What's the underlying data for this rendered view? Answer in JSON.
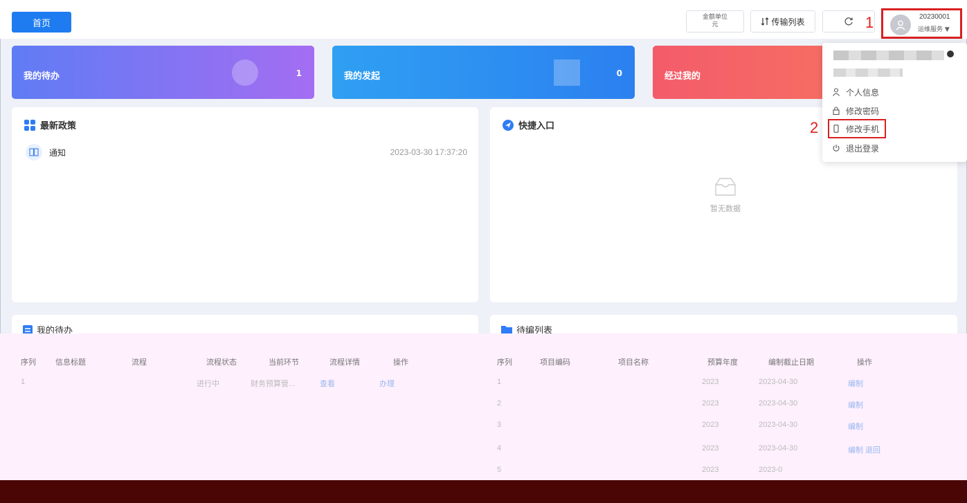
{
  "topbar": {
    "home_tab": "首页",
    "unit_label": "金额单位",
    "unit_value": "元",
    "transfer_list": "传输列表",
    "user_id": "20230001",
    "user_role": "运维服务"
  },
  "callouts": {
    "first": "1",
    "second": "2"
  },
  "stats": [
    {
      "label": "我的待办",
      "count": "1"
    },
    {
      "label": "我的发起",
      "count": "0"
    },
    {
      "label": "经过我的",
      "count": ""
    }
  ],
  "policy": {
    "title": "最新政策",
    "items": [
      {
        "text": "通知",
        "date": "2023-03-30 17:37:20"
      }
    ]
  },
  "quick": {
    "title": "快捷入口",
    "empty_text": "暂无数据"
  },
  "todo": {
    "title": "我的待办",
    "headers": [
      "序列",
      "信息标题",
      "流程",
      "流程状态",
      "当前环节",
      "流程详情",
      "操作"
    ],
    "rows": [
      {
        "seq": "1",
        "status": "进行中",
        "step": "财务预算管...",
        "detail": "查看",
        "action": "办理"
      }
    ]
  },
  "list": {
    "title": "待编列表",
    "headers": [
      "序列",
      "项目编码",
      "项目名称",
      "预算年度",
      "编制截止日期",
      "操作"
    ],
    "rows": [
      {
        "seq": "1",
        "year": "2023",
        "deadline": "2023-04-30",
        "action": "编制"
      },
      {
        "seq": "2",
        "year": "2023",
        "deadline": "2023-04-30",
        "action": "编制"
      },
      {
        "seq": "3",
        "year": "2023",
        "deadline": "2023-04-30",
        "action": "编制"
      },
      {
        "seq": "4",
        "year": "2023",
        "deadline": "2023-04-30",
        "action": "编制 退回"
      },
      {
        "seq": "5",
        "year": "2023",
        "deadline": "2023-0",
        "action": ""
      }
    ]
  },
  "dropdown": {
    "items": [
      "个人信息",
      "修改密码",
      "修改手机",
      "退出登录"
    ]
  }
}
